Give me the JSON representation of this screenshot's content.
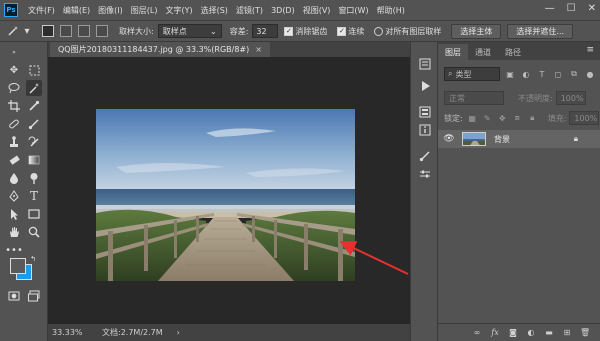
{
  "app": {
    "logo": "Ps"
  },
  "menu": [
    "文件(F)",
    "编辑(E)",
    "图像(I)",
    "图层(L)",
    "文字(Y)",
    "选择(S)",
    "滤镜(T)",
    "3D(D)",
    "视图(V)",
    "窗口(W)",
    "帮助(H)"
  ],
  "window_controls": {
    "minimize": "—",
    "maximize": "☐",
    "close": "✕"
  },
  "options": {
    "sample_size_label": "取样大小:",
    "sample_size_value": "取样点",
    "tolerance_label": "容差:",
    "tolerance_value": "32",
    "antialias_label": "消除锯齿",
    "contiguous_label": "连续",
    "all_layers_label": "对所有图层取样",
    "select_subject_btn": "选择主体",
    "select_mask_btn": "选择并遮住..."
  },
  "document": {
    "tab_title": "QQ图片20180311184437.jpg @ 33.3%(RGB/8#)",
    "tab_close": "×",
    "zoom": "33.33%",
    "info": "文档:2.7M/2.7M",
    "status_arrow": "›"
  },
  "layers_panel": {
    "tabs": [
      "图层",
      "通道",
      "路径"
    ],
    "menu_icon": "≡",
    "filter_placeholder": "类型",
    "blend_mode": "正常",
    "opacity_label": "不透明度:",
    "opacity_value": "100%",
    "lock_label": "锁定:",
    "fill_label": "填充:",
    "fill_value": "100%",
    "layers": [
      {
        "name": "背景",
        "visible": true,
        "locked": true
      }
    ]
  },
  "colors": {
    "foreground": "#5a5a5a",
    "background": "#1e9be8",
    "arrow": "#e53030",
    "accent": "#31a8ff"
  }
}
